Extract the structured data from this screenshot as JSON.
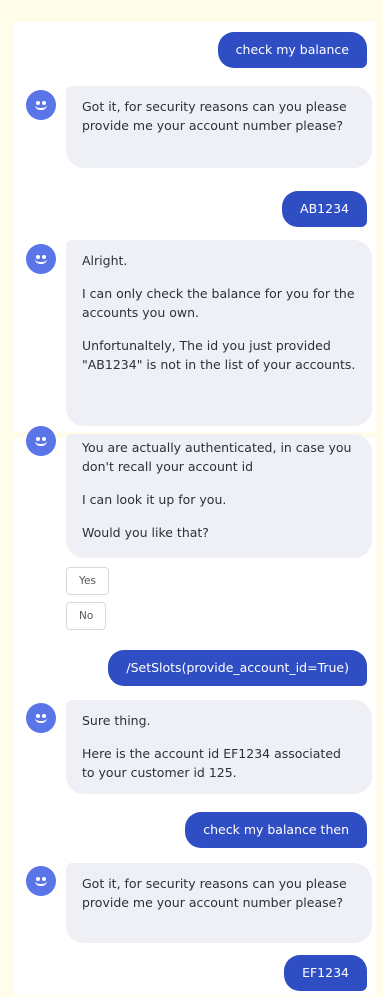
{
  "messages": {
    "u1": "check my balance",
    "b1": "Got it, for security reasons can you please provide me your account number please?",
    "u2": "AB1234",
    "b2_p1": "Alright.",
    "b2_p2": "I can only check the balance for you for the accounts you own.",
    "b2_p3": "Unfortunaltely, The id you just provided \"AB1234\" is not in the list of your accounts.",
    "b3_p1": "You are actually authenticated, in case you don't recall your account id",
    "b3_p2": "I can look it up for you.",
    "b3_p3": "Would you like that?",
    "quick_replies": [
      "Yes",
      "No"
    ],
    "u3": "/SetSlots(provide_account_id=True)",
    "b4_p1": "Sure thing.",
    "b4_p2": "Here is the account id EF1234 associated to your customer id 125.",
    "u4": "check my balance then",
    "b5": "Got it, for security reasons can you please provide me your account number please?",
    "u5": "EF1234"
  },
  "colors": {
    "page_background": "#fffde9",
    "user_bubble": "#2f4ec4",
    "bot_bubble": "#eef0f6",
    "avatar": "#5a75e8"
  },
  "icons": {
    "avatar": "smiley-bot-icon"
  }
}
